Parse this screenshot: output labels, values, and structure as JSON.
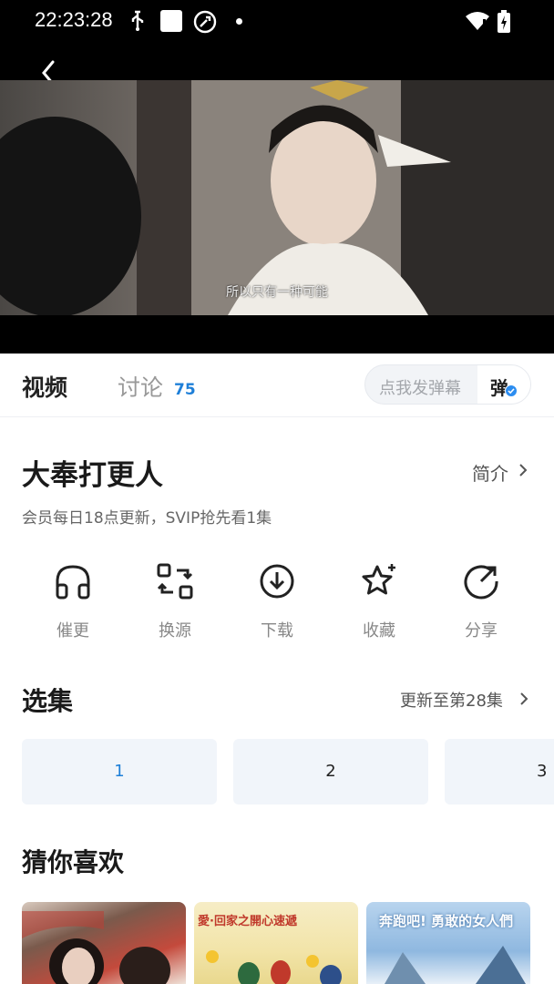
{
  "status_bar": {
    "time": "22:23:28"
  },
  "player": {
    "subtitle": "所以只有一种可能"
  },
  "tabs": {
    "video": "视频",
    "discuss": "讨论",
    "discuss_count": "75"
  },
  "danmaku": {
    "placeholder": "点我发弹幕",
    "toggle_label": "弹"
  },
  "show": {
    "title": "大奉打更人",
    "intro_label": "简介",
    "update_note": "会员每日18点更新，SVIP抢先看1集"
  },
  "actions": [
    {
      "label": "催更",
      "icon": "headphones-icon"
    },
    {
      "label": "换源",
      "icon": "switch-source-icon"
    },
    {
      "label": "下载",
      "icon": "download-icon"
    },
    {
      "label": "收藏",
      "icon": "star-icon"
    },
    {
      "label": "分享",
      "icon": "share-icon"
    }
  ],
  "episodes": {
    "title": "选集",
    "update_status": "更新至第28集",
    "items": [
      "1",
      "2",
      "3"
    ],
    "active_color": "#1e7fd8"
  },
  "recommendations": {
    "title": "猜你喜欢",
    "items": [
      {
        "poster_text": ""
      },
      {
        "poster_text": "愛·回家之開心速遞"
      },
      {
        "poster_text": "奔跑吧! 勇敢的女人們"
      }
    ]
  },
  "colors": {
    "accent": "#1e7fd8",
    "episode_bg": "#f1f5fa"
  }
}
